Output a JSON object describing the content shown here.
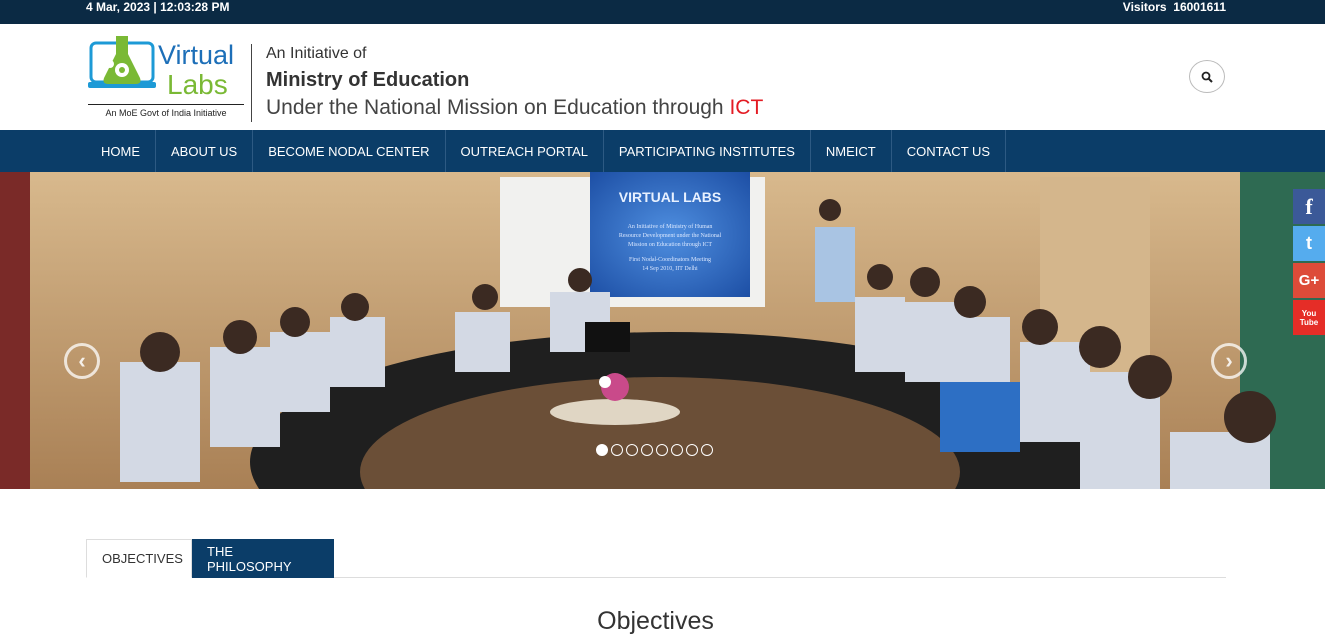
{
  "topbar": {
    "date": "4 Mar, 2023 | 12:03:28 PM",
    "visitors_label": "Visitors",
    "visitors_count": "16001611"
  },
  "header": {
    "logo": {
      "word1": "Virtual",
      "word2": "Labs",
      "caption": "An MoE Govt of India Initiative"
    },
    "initiative": "An Initiative of",
    "ministry": "Ministry of Education",
    "mission_prefix": "Under the National Mission on Education through ",
    "mission_ict": "ICT"
  },
  "nav": {
    "items": [
      "HOME",
      "ABOUT US",
      "BECOME NODAL CENTER",
      "OUTREACH PORTAL",
      "PARTICIPATING INSTITUTES",
      "NMEICT",
      "CONTACT US"
    ]
  },
  "slider": {
    "screen_title": "VIRTUAL LABS",
    "screen_lines": [
      "An Initiative of Ministry of Human",
      "Resource Development under the National",
      "Mission on Education through ICT",
      "First Nodal-Coordinators Meeting",
      "14 Sep 2010, IIT Delhi"
    ],
    "dot_count": 8,
    "active_dot": 0
  },
  "social": {
    "icons": [
      "facebook-icon",
      "twitter-icon",
      "google-plus-icon",
      "youtube-icon"
    ],
    "labels": [
      "f",
      "t",
      "G+",
      "You Tube"
    ],
    "colors": [
      "#3b5998",
      "#55acee",
      "#dd4b39",
      "#e52d27"
    ]
  },
  "tabs": [
    "OBJECTIVES",
    "THE PHILOSOPHY"
  ],
  "section": {
    "title": "Objectives"
  },
  "colors": {
    "navy": "#0b3d68",
    "topbar": "#0b2a44",
    "ict_red": "#e31b23",
    "logo_blue": "#1d6fb8",
    "logo_green": "#7ab935"
  }
}
